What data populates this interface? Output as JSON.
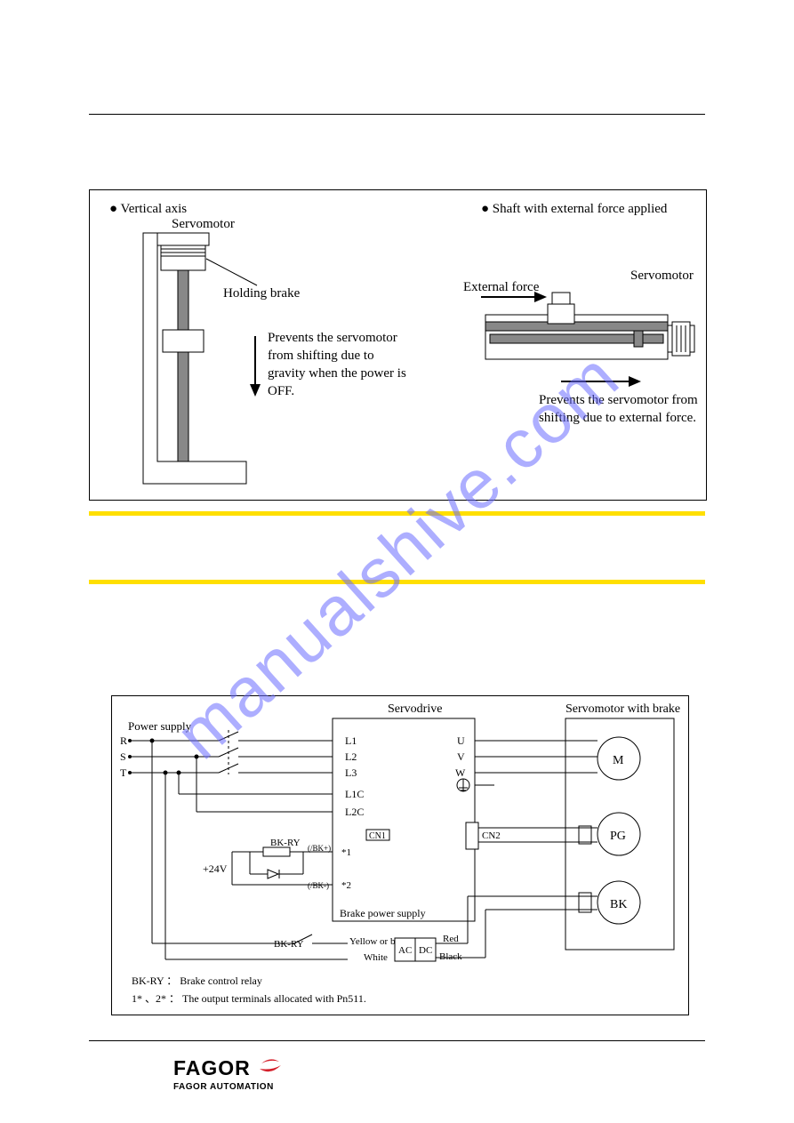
{
  "watermark": "manualshive.com",
  "logo": {
    "brand": "FAGOR",
    "sub": "FAGOR AUTOMATION"
  },
  "figure1": {
    "left": {
      "heading": "● Vertical axis",
      "servomotor": "Servomotor",
      "holding_brake": "Holding brake",
      "prevents_line1": "Prevents the servomotor",
      "prevents_line2": "from shifting due to",
      "prevents_line3": "gravity when the power is",
      "prevents_line4": "OFF."
    },
    "right": {
      "heading": "● Shaft with external force applied",
      "servomotor": "Servomotor",
      "external_force": "External force",
      "prevents_line1": "Prevents the servomotor from",
      "prevents_line2": "shifting due to external force."
    }
  },
  "figure2": {
    "power_supply": "Power supply",
    "phase_r": "R",
    "phase_s": "S",
    "phase_t": "T",
    "servodrive": "Servodrive",
    "servomotor_with_brake": "Servomotor with brake",
    "l1": "L1",
    "l2": "L2",
    "l3": "L3",
    "l1c": "L1C",
    "l2c": "L2C",
    "u": "U",
    "v": "V",
    "w": "W",
    "m": "M",
    "pg": "PG",
    "bk": "BK",
    "cn1": "CN1",
    "cn2": "CN2",
    "bk_ry": "BK-RY",
    "bk_plus": "(/BK+)",
    "bk_minus": "(/BK-)",
    "star1": "*1",
    "star2": "*2",
    "plus24v": "+24V",
    "brake_power_supply": "Brake power supply",
    "yellow_or_blue": "Yellow or blue",
    "white": "White",
    "ac": "AC",
    "dc": "DC",
    "red": "Red",
    "black": "Black",
    "note1": "BK-RY ： Brake control relay",
    "note2": "1* 、2* ： The output terminals allocated with Pn511."
  }
}
